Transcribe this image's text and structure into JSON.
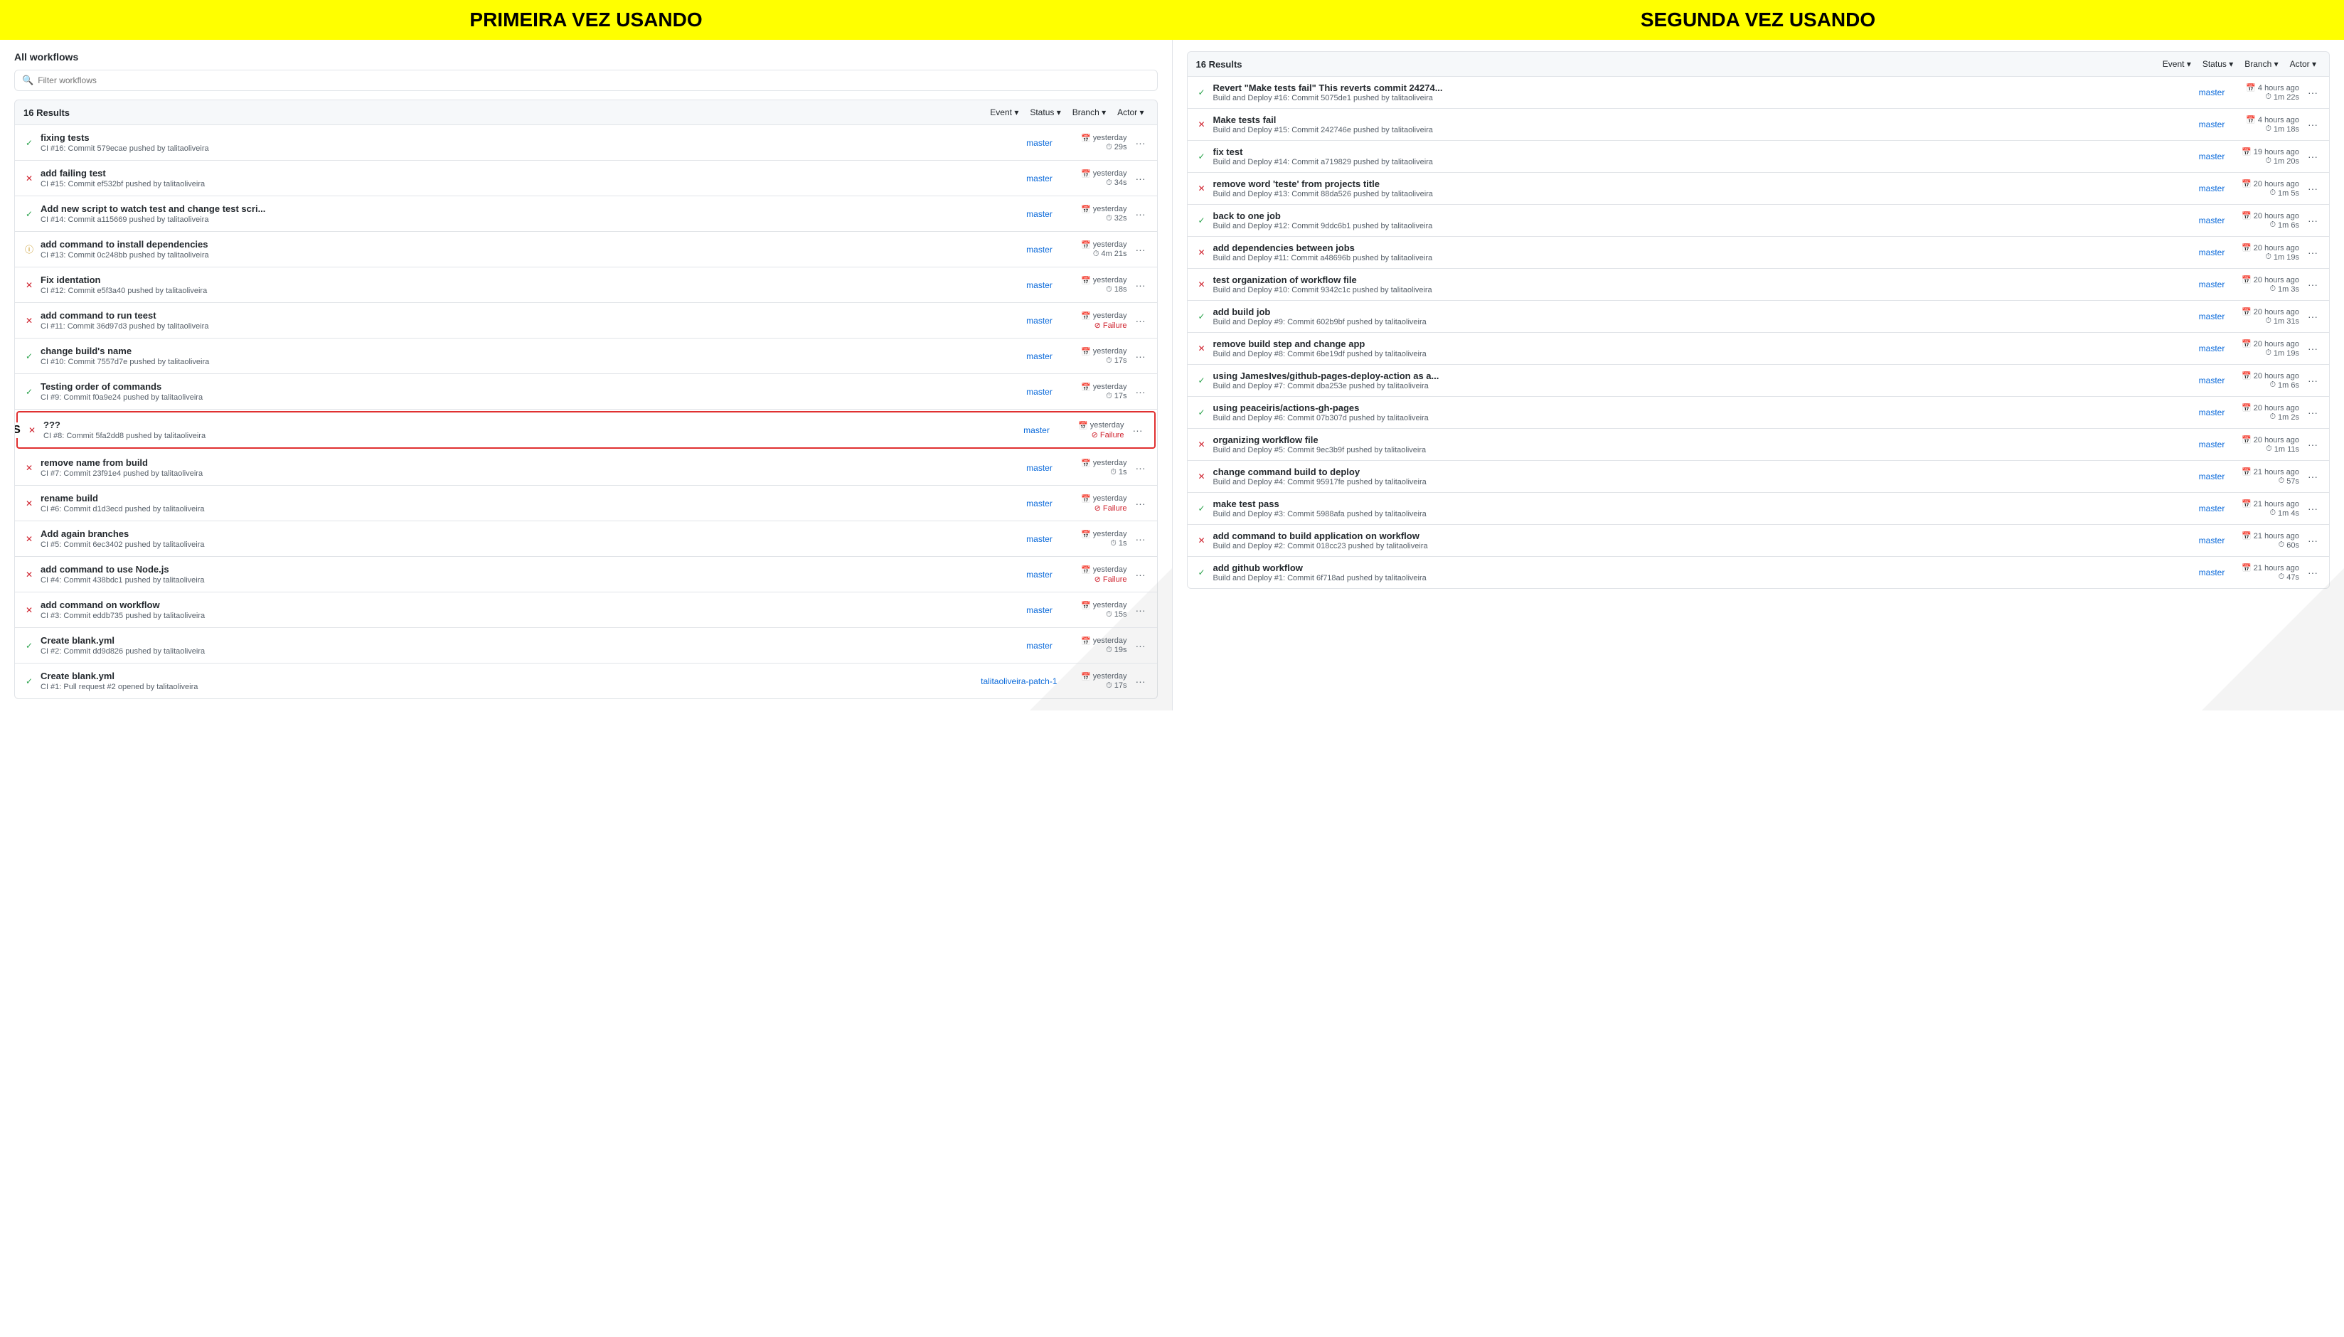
{
  "banners": {
    "left": "PRIMEIRA VEZ USANDO",
    "right": "SEGUNDA VEZ USANDO"
  },
  "left": {
    "title": "All workflows",
    "filter_placeholder": "Filter workflows",
    "results_count": "16 Results",
    "filter_buttons": [
      "Event ▾",
      "Status ▾",
      "Branch ▾",
      "Actor ▾"
    ],
    "risos_label": "RISOS",
    "workflows": [
      {
        "status": "success",
        "name": "fixing tests",
        "sub": "CI #16: Commit 579ecae pushed by talitaoliveira",
        "branch": "master",
        "time": "yesterday",
        "duration": "29s",
        "failure": false
      },
      {
        "status": "failure",
        "name": "add failing test",
        "sub": "CI #15: Commit ef532bf pushed by talitaoliveira",
        "branch": "master",
        "time": "yesterday",
        "duration": "34s",
        "failure": false
      },
      {
        "status": "success",
        "name": "Add new script to watch test and change test scri...",
        "sub": "CI #14: Commit a115669 pushed by talitaoliveira",
        "branch": "master",
        "time": "yesterday",
        "duration": "32s",
        "failure": false
      },
      {
        "status": "pending",
        "name": "add command to install dependencies",
        "sub": "CI #13: Commit 0c248bb pushed by talitaoliveira",
        "branch": "master",
        "time": "yesterday",
        "duration": "4m 21s",
        "failure": false
      },
      {
        "status": "failure",
        "name": "Fix identation",
        "sub": "CI #12: Commit e5f3a40 pushed by talitaoliveira",
        "branch": "master",
        "time": "yesterday",
        "duration": "18s",
        "failure": false
      },
      {
        "status": "failure",
        "name": "add command to run teest",
        "sub": "CI #11: Commit 36d97d3 pushed by talitaoliveira",
        "branch": "master",
        "time": "yesterday",
        "duration": "Failure",
        "failure": true
      },
      {
        "status": "success",
        "name": "change build's name",
        "sub": "CI #10: Commit 7557d7e pushed by talitaoliveira",
        "branch": "master",
        "time": "yesterday",
        "duration": "17s",
        "failure": false
      },
      {
        "status": "success",
        "name": "Testing order of commands",
        "sub": "CI #9: Commit f0a9e24 pushed by talitaoliveira",
        "branch": "master",
        "time": "yesterday",
        "duration": "17s",
        "failure": false
      },
      {
        "status": "failure",
        "name": "???",
        "sub": "CI #8: Commit 5fa2dd8 pushed by talitaoliveira",
        "branch": "master",
        "time": "yesterday",
        "duration": "Failure",
        "failure": true,
        "highlighted": true
      },
      {
        "status": "failure",
        "name": "remove name from build",
        "sub": "CI #7: Commit 23f91e4 pushed by talitaoliveira",
        "branch": "master",
        "time": "yesterday",
        "duration": "1s",
        "failure": false
      },
      {
        "status": "failure",
        "name": "rename build",
        "sub": "CI #6: Commit d1d3ecd pushed by talitaoliveira",
        "branch": "master",
        "time": "yesterday",
        "duration": "Failure",
        "failure": true
      },
      {
        "status": "failure",
        "name": "Add again branches",
        "sub": "CI #5: Commit 6ec3402 pushed by talitaoliveira",
        "branch": "master",
        "time": "yesterday",
        "duration": "1s",
        "failure": false
      },
      {
        "status": "failure",
        "name": "add command to use Node.js",
        "sub": "CI #4: Commit 438bdc1 pushed by talitaoliveira",
        "branch": "master",
        "time": "yesterday",
        "duration": "Failure",
        "failure": true
      },
      {
        "status": "failure",
        "name": "add command on workflow",
        "sub": "CI #3: Commit eddb735 pushed by talitaoliveira",
        "branch": "master",
        "time": "yesterday",
        "duration": "15s",
        "failure": false
      },
      {
        "status": "success",
        "name": "Create blank.yml",
        "sub": "CI #2: Commit dd9d826 pushed by talitaoliveira",
        "branch": "master",
        "time": "yesterday",
        "duration": "19s",
        "failure": false
      },
      {
        "status": "success",
        "name": "Create blank.yml",
        "sub": "CI #1: Pull request #2 opened by talitaoliveira",
        "branch": "talitaoliveira-patch-1",
        "time": "yesterday",
        "duration": "17s",
        "failure": false
      }
    ]
  },
  "right": {
    "results_count": "16 Results",
    "filter_buttons": [
      "Event ▾",
      "Status ▾",
      "Branch ▾",
      "Actor ▾"
    ],
    "workflows": [
      {
        "status": "success",
        "name": "Revert \"Make tests fail\" This reverts commit 24274...",
        "sub": "Build and Deploy #16: Commit 5075de1 pushed by talitaoliveira",
        "branch": "master",
        "time": "4 hours ago",
        "duration": "1m 22s"
      },
      {
        "status": "failure",
        "name": "Make tests fail",
        "sub": "Build and Deploy #15: Commit 242746e pushed by talitaoliveira",
        "branch": "master",
        "time": "4 hours ago",
        "duration": "1m 18s"
      },
      {
        "status": "success",
        "name": "fix test",
        "sub": "Build and Deploy #14: Commit a719829 pushed by talitaoliveira",
        "branch": "master",
        "time": "19 hours ago",
        "duration": "1m 20s"
      },
      {
        "status": "failure",
        "name": "remove word 'teste' from projects title",
        "sub": "Build and Deploy #13: Commit 88da526 pushed by talitaoliveira",
        "branch": "master",
        "time": "20 hours ago",
        "duration": "1m 5s"
      },
      {
        "status": "success",
        "name": "back to one job",
        "sub": "Build and Deploy #12: Commit 9ddc6b1 pushed by talitaoliveira",
        "branch": "master",
        "time": "20 hours ago",
        "duration": "1m 6s"
      },
      {
        "status": "failure",
        "name": "add dependencies between jobs",
        "sub": "Build and Deploy #11: Commit a48696b pushed by talitaoliveira",
        "branch": "master",
        "time": "20 hours ago",
        "duration": "1m 19s"
      },
      {
        "status": "failure",
        "name": "test organization of workflow file",
        "sub": "Build and Deploy #10: Commit 9342c1c pushed by talitaoliveira",
        "branch": "master",
        "time": "20 hours ago",
        "duration": "1m 3s"
      },
      {
        "status": "success",
        "name": "add build job",
        "sub": "Build and Deploy #9: Commit 602b9bf pushed by talitaoliveira",
        "branch": "master",
        "time": "20 hours ago",
        "duration": "1m 31s"
      },
      {
        "status": "failure",
        "name": "remove build step and change app",
        "sub": "Build and Deploy #8: Commit 6be19df pushed by talitaoliveira",
        "branch": "master",
        "time": "20 hours ago",
        "duration": "1m 19s"
      },
      {
        "status": "success",
        "name": "using JamesIves/github-pages-deploy-action as a...",
        "sub": "Build and Deploy #7: Commit dba253e pushed by talitaoliveira",
        "branch": "master",
        "time": "20 hours ago",
        "duration": "1m 6s"
      },
      {
        "status": "success",
        "name": "using peaceiris/actions-gh-pages",
        "sub": "Build and Deploy #6: Commit 07b307d pushed by talitaoliveira",
        "branch": "master",
        "time": "20 hours ago",
        "duration": "1m 2s"
      },
      {
        "status": "failure",
        "name": "organizing workflow file",
        "sub": "Build and Deploy #5: Commit 9ec3b9f pushed by talitaoliveira",
        "branch": "master",
        "time": "20 hours ago",
        "duration": "1m 11s"
      },
      {
        "status": "failure",
        "name": "change command build to deploy",
        "sub": "Build and Deploy #4: Commit 95917fe pushed by talitaoliveira",
        "branch": "master",
        "time": "21 hours ago",
        "duration": "57s"
      },
      {
        "status": "success",
        "name": "make test pass",
        "sub": "Build and Deploy #3: Commit 5988afa pushed by talitaoliveira",
        "branch": "master",
        "time": "21 hours ago",
        "duration": "1m 4s"
      },
      {
        "status": "failure",
        "name": "add command to build application on workflow",
        "sub": "Build and Deploy #2: Commit 018cc23 pushed by talitaoliveira",
        "branch": "master",
        "time": "21 hours ago",
        "duration": "60s"
      },
      {
        "status": "success",
        "name": "add github workflow",
        "sub": "Build and Deploy #1: Commit 6f718ad pushed by talitaoliveira",
        "branch": "master",
        "time": "21 hours ago",
        "duration": "47s"
      }
    ]
  }
}
